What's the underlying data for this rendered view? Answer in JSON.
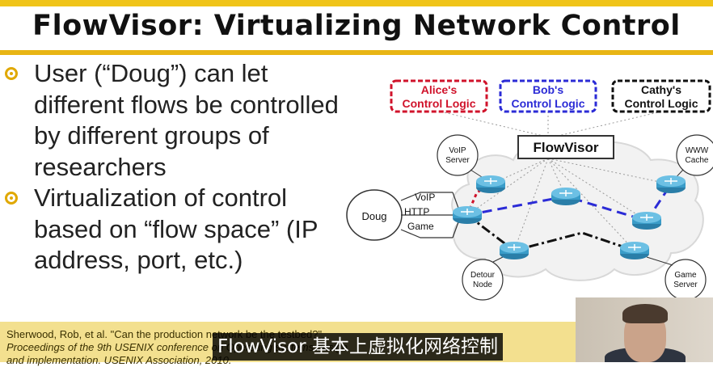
{
  "slide": {
    "title": "FlowVisor: Virtualizing Network Control",
    "bullets": [
      "User (“Doug”) can let different flows be controlled by different groups of researchers",
      "Virtualization of control based on “flow space” (IP address, port, etc.)"
    ]
  },
  "diagram": {
    "controllers": [
      {
        "line1": "Alice's",
        "line2": "Control Logic",
        "color": "#d0132b"
      },
      {
        "line1": "Bob's",
        "line2": "Control Logic",
        "color": "#2b2bd6"
      },
      {
        "line1": "Cathy's",
        "line2": "Control Logic",
        "color": "#111111"
      }
    ],
    "flowvisor_label": "FlowVisor",
    "user_label": "Doug",
    "flow_labels": [
      "VoIP",
      "HTTP",
      "Game"
    ],
    "nodes": {
      "voip": [
        "VoIP",
        "Server"
      ],
      "www": [
        "WWW",
        "Cache"
      ],
      "detour": [
        "Detour",
        "Node"
      ],
      "game": [
        "Game",
        "Server"
      ]
    }
  },
  "citation": {
    "line1": "Sherwood, Rob, et al. \"Can the production network be the testbed?\"",
    "line2": "Proceedings of the 9th USENIX conference on Operating systems design",
    "line3": "and implementation. USENIX Association, 2010."
  },
  "subtitle": "FlowVisor 基本上虚拟化网络控制",
  "colors": {
    "accent": "#e8b514",
    "alice": "#d0132b",
    "bob": "#2b2bd6",
    "cathy": "#111111"
  }
}
